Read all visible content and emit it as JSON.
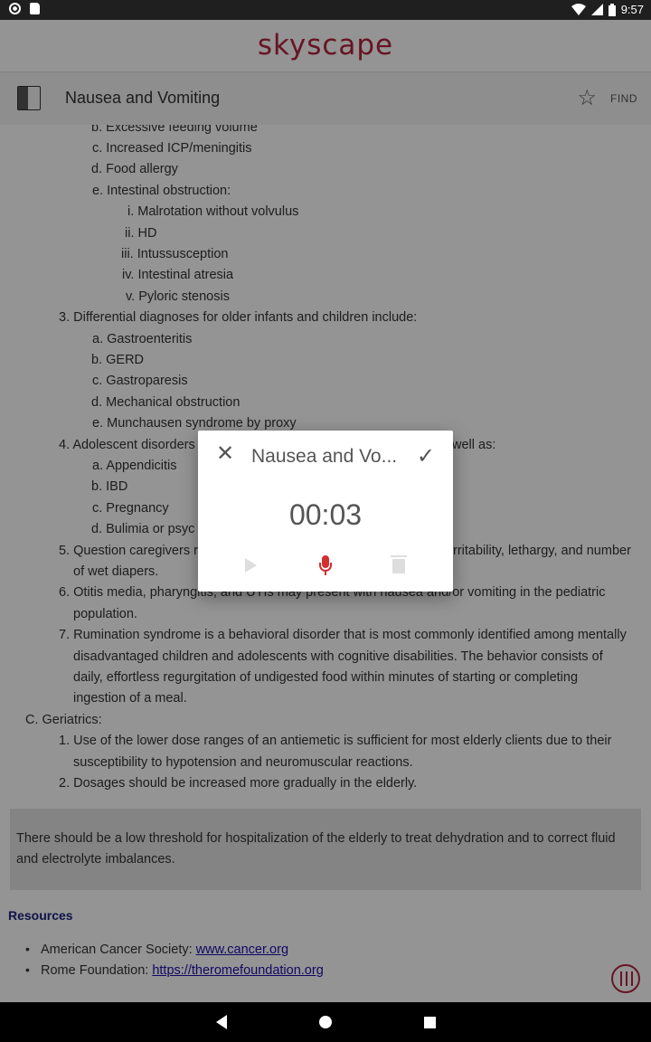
{
  "status_bar": {
    "time": "9:57",
    "icons": [
      "record-icon",
      "sd-card-icon",
      "wifi-icon",
      "signal-icon",
      "battery-icon"
    ]
  },
  "app": {
    "brand": "skyscape",
    "page_title": "Nausea and Vomiting",
    "find_label": "FIND",
    "accent_color": "#b2243f"
  },
  "content": {
    "lines": [
      "b. Excessive feeding volume",
      "c. Increased ICP/meningitis",
      "d. Food allergy",
      "e. Intestinal obstruction:",
      "i. Malrotation without volvulus",
      "ii. HD",
      "iii. Intussusception",
      "iv. Intestinal atresia",
      "v. Pyloric stenosis",
      "3. Differential diagnoses for older infants and children include:",
      "a. Gastroenteritis",
      "b. GERD",
      "c. Gastroparesis",
      "d. Mechanical obstruction",
      "e. Munchausen syndrome by proxy",
      "4. Adolescent disorders",
      "well as:",
      "a. Appendicitis",
      "b. IBD",
      "c. Pregnancy",
      "d. Bulimia or psyc",
      "5. Question caregivers r",
      "rritability, lethargy, and number",
      "of wet diapers.",
      "6. Otitis media, pharyngitis, and UTIs may present with nausea and/or vomiting in the pediatric",
      "population.",
      "7. Rumination syndrome is a behavioral disorder that is most commonly identified among mentally",
      "disadvantaged children and adolescents with cognitive disabilities. The behavior consists of",
      "daily, effortless regurgitation of undigested food within minutes of starting or completing",
      "ingestion of a meal.",
      "C. Geriatrics:",
      "1. Use of the lower dose ranges of an antiemetic is sufficient for most elderly clients due to their",
      "susceptibility to hypotension and neuromuscular reactions.",
      "2. Dosages should be increased more gradually in the elderly."
    ],
    "note_lines": [
      "There should be a low threshold for hospitalization of the elderly to treat dehydration and to correct fluid",
      "and electrolyte imbalances."
    ],
    "resources_title": "Resources",
    "resources": [
      {
        "label": "American Cancer Society: ",
        "link": "www.cancer.org"
      },
      {
        "label": "Rome Foundation: ",
        "link": "https://theromefoundation.org"
      }
    ]
  },
  "dialog": {
    "title": "Nausea and Vo...",
    "timer": "00:03",
    "record_color": "#d32f2f"
  }
}
